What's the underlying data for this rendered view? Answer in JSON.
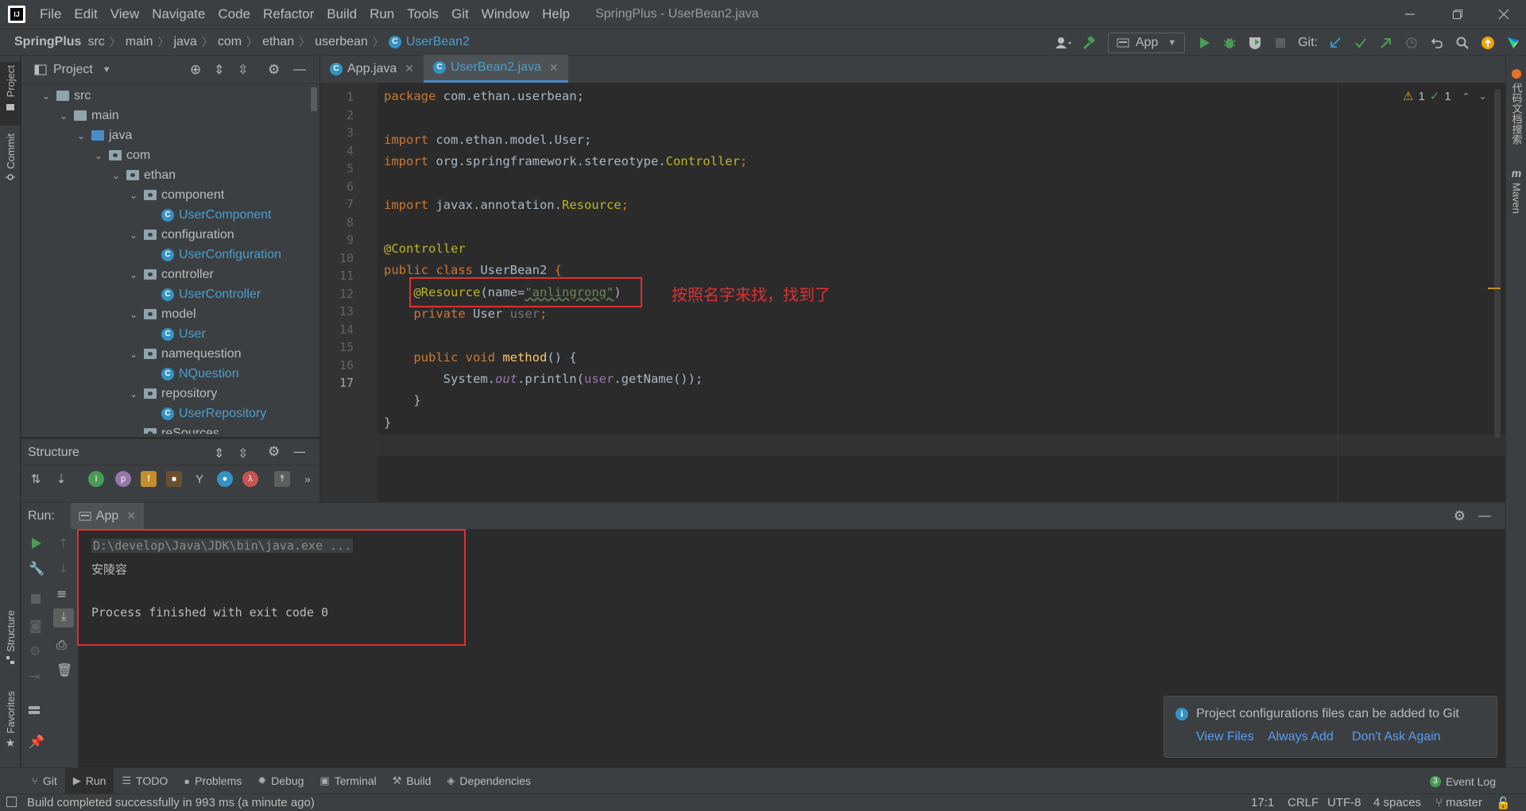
{
  "window": {
    "logo_text": "IJ",
    "title": "SpringPlus - UserBean2.java",
    "menu": [
      "File",
      "Edit",
      "View",
      "Navigate",
      "Code",
      "Refactor",
      "Build",
      "Run",
      "Tools",
      "Git",
      "Window",
      "Help"
    ]
  },
  "breadcrumb": {
    "items": [
      "SpringPlus",
      "src",
      "main",
      "java",
      "com",
      "ethan",
      "userbean",
      "UserBean2"
    ]
  },
  "toolbar": {
    "run_config": "App",
    "git_label": "Git:"
  },
  "left_strip": {
    "project": "Project",
    "commit": "Commit",
    "structure": "Structure",
    "favorites": "Favorites"
  },
  "right_strip": {
    "plugin": "代码文档搜索",
    "maven": "Maven"
  },
  "project_panel": {
    "title": "Project",
    "tree": [
      {
        "label": "src",
        "kind": "folder"
      },
      {
        "label": "main",
        "kind": "folder"
      },
      {
        "label": "java",
        "kind": "folder-blue"
      },
      {
        "label": "com",
        "kind": "package"
      },
      {
        "label": "ethan",
        "kind": "package"
      },
      {
        "label": "component",
        "kind": "package"
      },
      {
        "label": "UserComponent",
        "kind": "class"
      },
      {
        "label": "configuration",
        "kind": "package"
      },
      {
        "label": "UserConfiguration",
        "kind": "class"
      },
      {
        "label": "controller",
        "kind": "package"
      },
      {
        "label": "UserController",
        "kind": "class"
      },
      {
        "label": "model",
        "kind": "package"
      },
      {
        "label": "User",
        "kind": "class"
      },
      {
        "label": "namequestion",
        "kind": "package"
      },
      {
        "label": "NQuestion",
        "kind": "class"
      },
      {
        "label": "repository",
        "kind": "package"
      },
      {
        "label": "UserRepository",
        "kind": "class"
      },
      {
        "label": "reSources",
        "kind": "package"
      }
    ]
  },
  "structure_panel": {
    "title": "Structure"
  },
  "editor": {
    "tabs": [
      {
        "label": "App.java",
        "active": false
      },
      {
        "label": "UserBean2.java",
        "active": true
      }
    ],
    "line_numbers": [
      "1",
      "2",
      "3",
      "4",
      "5",
      "6",
      "7",
      "8",
      "9",
      "10",
      "11",
      "12",
      "13",
      "14",
      "15",
      "16",
      "17"
    ],
    "inspection": {
      "warnings": "1",
      "checks": "1"
    },
    "annotation_note": "按照名字来找，找到了"
  },
  "code": {
    "l1_kw": "package",
    "l1_rest": " com.ethan.userbean;",
    "l3_kw": "import",
    "l3_rest": " com.ethan.model.User;",
    "l4_kw": "import",
    "l4_rest": " org.springframework.stereotype.",
    "l4_ann": "Controller",
    "l4_end": ";",
    "l6_kw": "import",
    "l6_rest": " javax.annotation.",
    "l6_ann": "Resource",
    "l6_end": ";",
    "l8_ann": "@Controller",
    "l9_kw": "public class",
    "l9_name": " UserBean2 ",
    "l9_brace": "{",
    "l10_ann": "@Resource",
    "l10_open": "(name=",
    "l10_str": "\"anlingrong\"",
    "l10_close": ")",
    "l11_kw": "private",
    "l11_type": " User ",
    "l11_field": "user",
    "l11_end": ";",
    "l13_kw": "public void",
    "l13_fn": " method",
    "l13_rest": "() {",
    "l14_a": "System.",
    "l14_out": "out",
    "l14_b": ".println(",
    "l14_user": "user",
    "l14_c": ".getName());",
    "l15": "}",
    "l16": "}"
  },
  "run_panel": {
    "label": "Run:",
    "tab": "App",
    "console": {
      "cmd": "D:\\develop\\Java\\JDK\\bin\\java.exe ...",
      "output": "安陵容",
      "exit": "Process finished with exit code 0"
    }
  },
  "notification": {
    "message": "Project configurations files can be added to Git",
    "actions": [
      "View Files",
      "Always Add",
      "Don't Ask Again"
    ]
  },
  "bottom_tools": {
    "git": "Git",
    "run": "Run",
    "todo": "TODO",
    "problems": "Problems",
    "debug": "Debug",
    "terminal": "Terminal",
    "build": "Build",
    "dependencies": "Dependencies",
    "event_log": "Event Log",
    "event_count": "3"
  },
  "status": {
    "message": "Build completed successfully in 993 ms (a minute ago)",
    "position": "17:1",
    "line_sep": "CRLF",
    "encoding": "UTF-8",
    "indent": "4 spaces",
    "branch": "master"
  },
  "colors": {
    "accent": "#4a88c7",
    "keyword": "#cc7832",
    "annotation": "#bbb529",
    "string": "#6a8759",
    "highlight_box": "#e03030",
    "link": "#589df6"
  }
}
